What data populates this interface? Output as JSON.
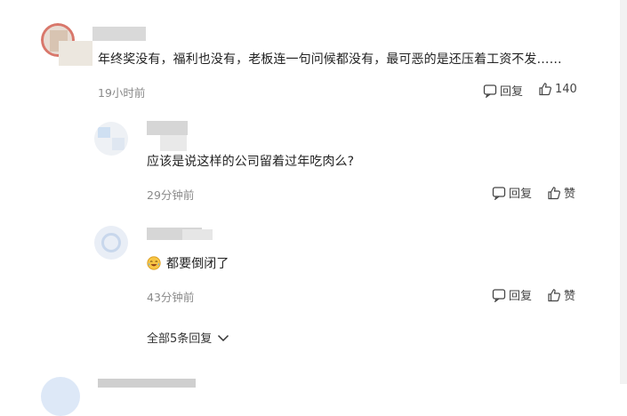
{
  "comments": [
    {
      "text": "年终奖没有，福利也没有，老板连一句问候都没有，最可恶的是还压着工资不发……",
      "time": "19小时前",
      "reply_label": "回复",
      "like_label": "140"
    },
    {
      "text": "应该是说这样的公司留着过年吃肉么?",
      "time": "29分钟前",
      "reply_label": "回复",
      "like_label": "赞"
    },
    {
      "text": "都要倒闭了",
      "time": "43分钟前",
      "reply_label": "回复",
      "like_label": "赞"
    }
  ],
  "expand_label": "全部5条回复",
  "icons": {
    "reply": "speech-bubble-icon",
    "like": "thumbs-up-icon",
    "expand": "chevron-down-icon",
    "emoji": "crying-laughing-emoji-icon"
  },
  "colors": {
    "text": "#222222",
    "meta": "#8a8a8a",
    "action": "#444444"
  }
}
